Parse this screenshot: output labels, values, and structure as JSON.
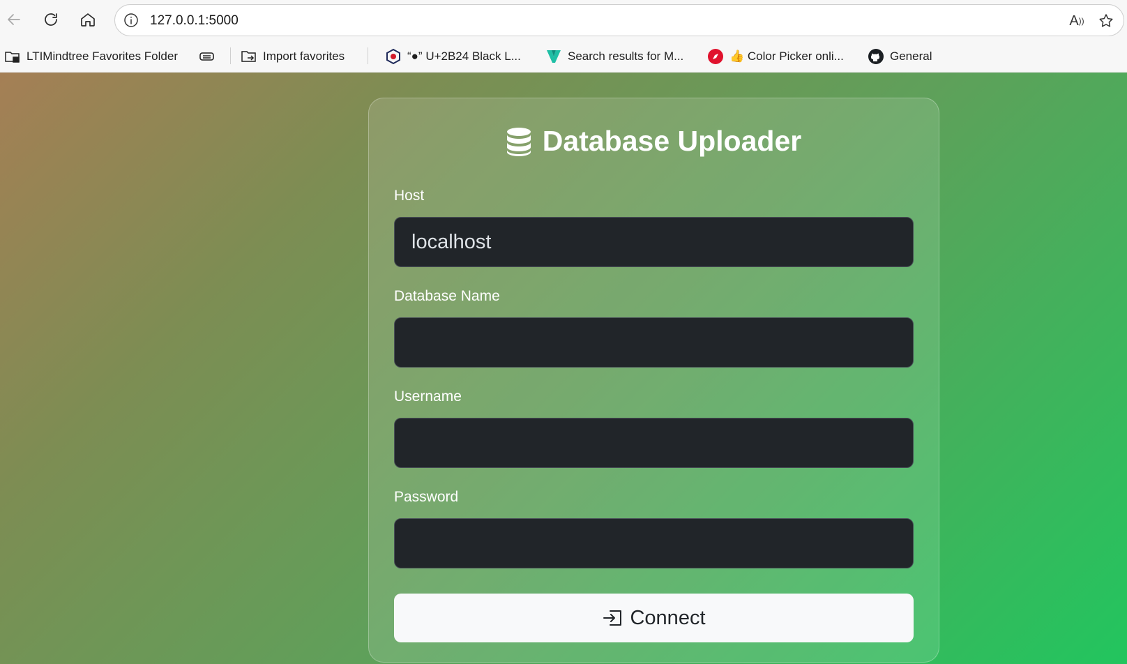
{
  "browser": {
    "url": "127.0.0.1:5000",
    "read_aloud_label": "A",
    "bookmarks": [
      {
        "label": "LTIMindtree Favorites Folder",
        "icon": "folder-lock-icon"
      },
      {
        "label": "",
        "icon": "collections-icon"
      },
      {
        "label": "Import favorites",
        "icon": "import-folder-icon"
      },
      {
        "label": "“●” U+2B24 Black L...",
        "icon": "hex-logo-icon"
      },
      {
        "label": "Search results for M...",
        "icon": "v-logo-icon"
      },
      {
        "label": "👍 Color Picker onli...",
        "icon": "compass-icon"
      },
      {
        "label": "General",
        "icon": "github-icon"
      }
    ]
  },
  "page": {
    "title": "Database Uploader",
    "accent_gradient": [
      "#a57f55",
      "#22c55e"
    ],
    "fields": {
      "host": {
        "label": "Host",
        "value": "localhost"
      },
      "database": {
        "label": "Database Name",
        "value": ""
      },
      "username": {
        "label": "Username",
        "value": ""
      },
      "password": {
        "label": "Password",
        "value": ""
      }
    },
    "connect_label": "Connect"
  }
}
